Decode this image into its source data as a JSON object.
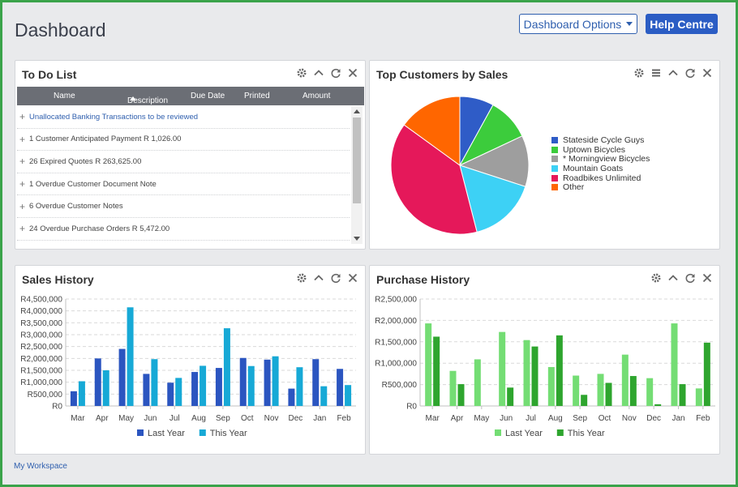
{
  "header": {
    "title": "Dashboard",
    "options_label": "Dashboard Options",
    "help_label": "Help Centre"
  },
  "todo": {
    "title": "To Do List",
    "columns": {
      "name": "Name",
      "description": "Description",
      "due_date": "Due Date",
      "printed": "Printed",
      "amount": "Amount"
    },
    "items": [
      {
        "text": "Unallocated Banking Transactions to be reviewed"
      },
      {
        "text": "1 Customer Anticipated Payment R 1,026.00"
      },
      {
        "text": "26 Expired Quotes R 263,625.00"
      },
      {
        "text": "1 Overdue Customer Document Note"
      },
      {
        "text": "6 Overdue Customer Notes"
      },
      {
        "text": "24 Overdue Purchase Orders R 5,472.00"
      }
    ]
  },
  "top_customers": {
    "title": "Top Customers by Sales",
    "chart_data": {
      "type": "pie",
      "slices": [
        {
          "label": "Stateside Cycle Guys",
          "value": 8,
          "color": "#2f5cc7"
        },
        {
          "label": "Uptown Bicycles",
          "value": 10,
          "color": "#3ccc3c"
        },
        {
          "label": "* Morningview Bicycles",
          "value": 12,
          "color": "#9e9e9e"
        },
        {
          "label": "Mountain Goats",
          "value": 16,
          "color": "#3dd1f5"
        },
        {
          "label": "Roadbikes Unlimited",
          "value": 39,
          "color": "#e5185a"
        },
        {
          "label": "Other",
          "value": 15,
          "color": "#ff6600"
        }
      ],
      "legend_position": "right"
    }
  },
  "sales_history": {
    "title": "Sales History",
    "chart_data": {
      "type": "bar",
      "categories": [
        "Mar",
        "Apr",
        "May",
        "Jun",
        "Jul",
        "Aug",
        "Sep",
        "Oct",
        "Nov",
        "Dec",
        "Jan",
        "Feb"
      ],
      "series": [
        {
          "name": "Last Year",
          "color": "#2b55c0",
          "values": [
            620000,
            2000000,
            2400000,
            1350000,
            980000,
            1430000,
            1600000,
            2020000,
            1950000,
            730000,
            1970000,
            1560000
          ]
        },
        {
          "name": "This Year",
          "color": "#17a9d6",
          "values": [
            1040000,
            1500000,
            4150000,
            1970000,
            1180000,
            1690000,
            3270000,
            1680000,
            2090000,
            1630000,
            830000,
            880000
          ]
        }
      ],
      "y_ticks": [
        "R0",
        "R500,000",
        "R1,000,000",
        "R1,500,000",
        "R2,000,000",
        "R2,500,000",
        "R3,000,000",
        "R3,500,000",
        "R4,000,000",
        "R4,500,000"
      ],
      "ylim": [
        0,
        4500000
      ],
      "grid": true,
      "legend_position": "bottom"
    }
  },
  "purchase_history": {
    "title": "Purchase History",
    "chart_data": {
      "type": "bar",
      "categories": [
        "Mar",
        "Apr",
        "May",
        "Jun",
        "Jul",
        "Aug",
        "Sep",
        "Oct",
        "Nov",
        "Dec",
        "Jan",
        "Feb"
      ],
      "series": [
        {
          "name": "Last Year",
          "color": "#74dd74",
          "values": [
            1930000,
            820000,
            1090000,
            1730000,
            1540000,
            910000,
            710000,
            750000,
            1200000,
            650000,
            1930000,
            410000
          ]
        },
        {
          "name": "This Year",
          "color": "#2ea52e",
          "values": [
            1620000,
            510000,
            0,
            430000,
            1390000,
            1650000,
            260000,
            540000,
            700000,
            40000,
            510000,
            1480000
          ]
        }
      ],
      "y_ticks": [
        "R0",
        "R500,000",
        "R1,000,000",
        "R1,500,000",
        "R2,000,000",
        "R2,500,000"
      ],
      "ylim": [
        0,
        2500000
      ],
      "grid": true,
      "legend_position": "bottom"
    }
  },
  "footer": {
    "workspace_label": "My Workspace"
  },
  "icons": [
    "gear-icon",
    "chevron-up-icon",
    "refresh-icon",
    "close-icon",
    "list-icon",
    "plus-icon",
    "sort-asc-icon",
    "caret-down-icon"
  ]
}
